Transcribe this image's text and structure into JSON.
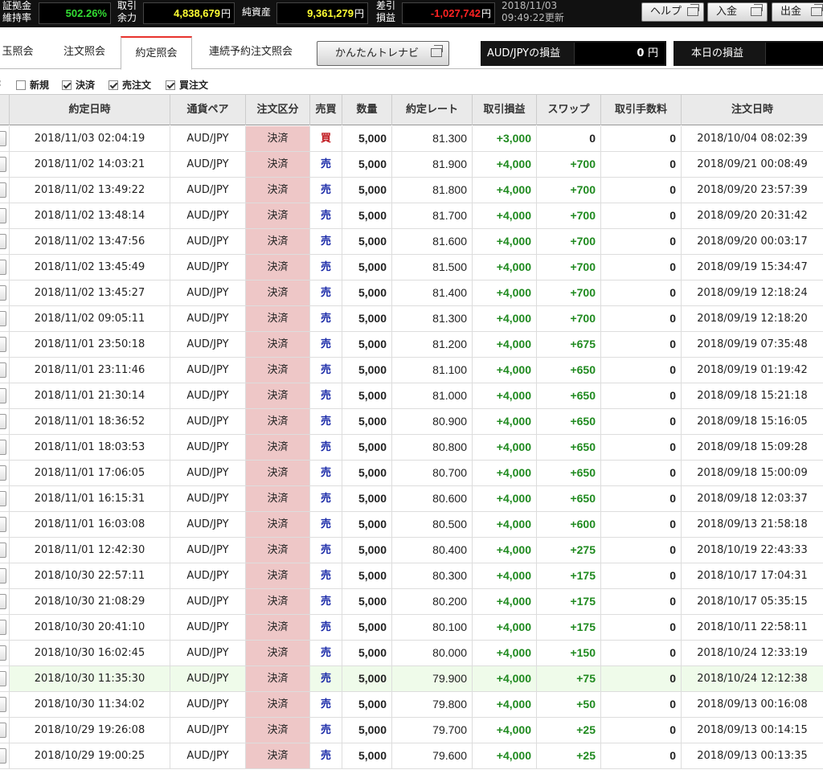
{
  "topbar": {
    "margin_label_1": "証拠金",
    "margin_label_2": "維持率",
    "margin_ratio": "502.26%",
    "available_label_1": "取引",
    "available_label_2": "余力",
    "available_value": "4,838,679",
    "net_assets_label": "純資産",
    "net_assets_value": "9,361,279",
    "diff_label_1": "差引",
    "diff_label_2": "損益",
    "diff_value": "-1,027,742",
    "yen": "円",
    "update_date": "2018/11/03",
    "update_time": "09:49:22更新",
    "help_button": "ヘルプ",
    "deposit_button": "入金",
    "withdraw_button": "出金",
    "colors": {
      "positive": "#33dd33",
      "neutral": "#ffff33",
      "negative": "#ff2222"
    }
  },
  "tabs": [
    {
      "label": "玉照会",
      "active": false
    },
    {
      "label": "注文照会",
      "active": false
    },
    {
      "label": "約定照会",
      "active": true
    },
    {
      "label": "連続予約注文照会",
      "active": false
    }
  ],
  "tool_button": "かんたんトレナビ",
  "pl_pair": {
    "label": "AUD/JPYの損益",
    "value": "0",
    "unit": "円"
  },
  "pl_today": {
    "label": "本日の損益",
    "value": ""
  },
  "filters": [
    {
      "label": "新規",
      "checked": false
    },
    {
      "label": "決済",
      "checked": true
    },
    {
      "label": "売注文",
      "checked": true
    },
    {
      "label": "買注文",
      "checked": true
    }
  ],
  "columns": [
    "約定日時",
    "通貨ペア",
    "注文区分",
    "売買",
    "数量",
    "約定レート",
    "取引損益",
    "スワップ",
    "取引手数料",
    "注文日時"
  ],
  "rows": [
    [
      "2018/11/03 02:04:19",
      "AUD/JPY",
      "決済",
      "買",
      "5,000",
      "81.300",
      "+3,000",
      "0",
      "0",
      "2018/10/04 08:02:39"
    ],
    [
      "2018/11/02 14:03:21",
      "AUD/JPY",
      "決済",
      "売",
      "5,000",
      "81.900",
      "+4,000",
      "+700",
      "0",
      "2018/09/21 00:08:49"
    ],
    [
      "2018/11/02 13:49:22",
      "AUD/JPY",
      "決済",
      "売",
      "5,000",
      "81.800",
      "+4,000",
      "+700",
      "0",
      "2018/09/20 23:57:39"
    ],
    [
      "2018/11/02 13:48:14",
      "AUD/JPY",
      "決済",
      "売",
      "5,000",
      "81.700",
      "+4,000",
      "+700",
      "0",
      "2018/09/20 20:31:42"
    ],
    [
      "2018/11/02 13:47:56",
      "AUD/JPY",
      "決済",
      "売",
      "5,000",
      "81.600",
      "+4,000",
      "+700",
      "0",
      "2018/09/20 00:03:17"
    ],
    [
      "2018/11/02 13:45:49",
      "AUD/JPY",
      "決済",
      "売",
      "5,000",
      "81.500",
      "+4,000",
      "+700",
      "0",
      "2018/09/19 15:34:47"
    ],
    [
      "2018/11/02 13:45:27",
      "AUD/JPY",
      "決済",
      "売",
      "5,000",
      "81.400",
      "+4,000",
      "+700",
      "0",
      "2018/09/19 12:18:24"
    ],
    [
      "2018/11/02 09:05:11",
      "AUD/JPY",
      "決済",
      "売",
      "5,000",
      "81.300",
      "+4,000",
      "+700",
      "0",
      "2018/09/19 12:18:20"
    ],
    [
      "2018/11/01 23:50:18",
      "AUD/JPY",
      "決済",
      "売",
      "5,000",
      "81.200",
      "+4,000",
      "+675",
      "0",
      "2018/09/19 07:35:48"
    ],
    [
      "2018/11/01 23:11:46",
      "AUD/JPY",
      "決済",
      "売",
      "5,000",
      "81.100",
      "+4,000",
      "+650",
      "0",
      "2018/09/19 01:19:42"
    ],
    [
      "2018/11/01 21:30:14",
      "AUD/JPY",
      "決済",
      "売",
      "5,000",
      "81.000",
      "+4,000",
      "+650",
      "0",
      "2018/09/18 15:21:18"
    ],
    [
      "2018/11/01 18:36:52",
      "AUD/JPY",
      "決済",
      "売",
      "5,000",
      "80.900",
      "+4,000",
      "+650",
      "0",
      "2018/09/18 15:16:05"
    ],
    [
      "2018/11/01 18:03:53",
      "AUD/JPY",
      "決済",
      "売",
      "5,000",
      "80.800",
      "+4,000",
      "+650",
      "0",
      "2018/09/18 15:09:28"
    ],
    [
      "2018/11/01 17:06:05",
      "AUD/JPY",
      "決済",
      "売",
      "5,000",
      "80.700",
      "+4,000",
      "+650",
      "0",
      "2018/09/18 15:00:09"
    ],
    [
      "2018/11/01 16:15:31",
      "AUD/JPY",
      "決済",
      "売",
      "5,000",
      "80.600",
      "+4,000",
      "+650",
      "0",
      "2018/09/18 12:03:37"
    ],
    [
      "2018/11/01 16:03:08",
      "AUD/JPY",
      "決済",
      "売",
      "5,000",
      "80.500",
      "+4,000",
      "+600",
      "0",
      "2018/09/13 21:58:18"
    ],
    [
      "2018/11/01 12:42:30",
      "AUD/JPY",
      "決済",
      "売",
      "5,000",
      "80.400",
      "+4,000",
      "+275",
      "0",
      "2018/10/19 22:43:33"
    ],
    [
      "2018/10/30 22:57:11",
      "AUD/JPY",
      "決済",
      "売",
      "5,000",
      "80.300",
      "+4,000",
      "+175",
      "0",
      "2018/10/17 17:04:31"
    ],
    [
      "2018/10/30 21:08:29",
      "AUD/JPY",
      "決済",
      "売",
      "5,000",
      "80.200",
      "+4,000",
      "+175",
      "0",
      "2018/10/17 05:35:15"
    ],
    [
      "2018/10/30 20:41:10",
      "AUD/JPY",
      "決済",
      "売",
      "5,000",
      "80.100",
      "+4,000",
      "+175",
      "0",
      "2018/10/11 22:58:11"
    ],
    [
      "2018/10/30 16:02:45",
      "AUD/JPY",
      "決済",
      "売",
      "5,000",
      "80.000",
      "+4,000",
      "+150",
      "0",
      "2018/10/24 12:33:19"
    ],
    [
      "2018/10/30 11:35:30",
      "AUD/JPY",
      "決済",
      "売",
      "5,000",
      "79.900",
      "+4,000",
      "+75",
      "0",
      "2018/10/24 12:12:38"
    ],
    [
      "2018/10/30 11:34:02",
      "AUD/JPY",
      "決済",
      "売",
      "5,000",
      "79.800",
      "+4,000",
      "+50",
      "0",
      "2018/09/13 00:16:08"
    ],
    [
      "2018/10/29 19:26:08",
      "AUD/JPY",
      "決済",
      "売",
      "5,000",
      "79.700",
      "+4,000",
      "+25",
      "0",
      "2018/09/13 00:14:15"
    ],
    [
      "2018/10/29 19:00:25",
      "AUD/JPY",
      "決済",
      "売",
      "5,000",
      "79.600",
      "+4,000",
      "+25",
      "0",
      "2018/09/13 00:13:35"
    ]
  ],
  "highlighted_row": 21
}
